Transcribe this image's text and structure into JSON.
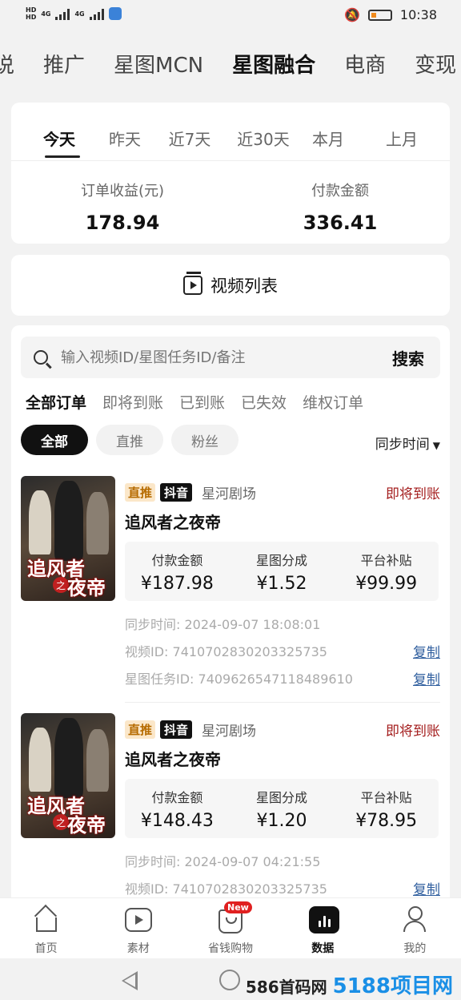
{
  "status_bar": {
    "time": "10:38",
    "hd": "HD",
    "net": "4G"
  },
  "top_tabs": [
    "说",
    "推广",
    "星图MCN",
    "星图融合",
    "电商",
    "变现"
  ],
  "date_tabs": [
    "今天",
    "昨天",
    "近7天",
    "近30天",
    "本月",
    "上月"
  ],
  "summary": {
    "order_income_label": "订单收益(元)",
    "order_income_value": "178.94",
    "payment_label": "付款金额",
    "payment_value": "336.41"
  },
  "video_list_label": "视频列表",
  "search": {
    "placeholder": "输入视频ID/星图任务ID/备注",
    "button": "搜索"
  },
  "order_tabs": [
    "全部订单",
    "即将到账",
    "已到账",
    "已失效",
    "维权订单"
  ],
  "chips": [
    "全部",
    "直推",
    "粉丝"
  ],
  "sort_label": "同步时间",
  "orders": [
    {
      "tag_type": "直推",
      "platform": "抖音",
      "source": "星河剧场",
      "status": "即将到账",
      "title": "追风者之夜帝",
      "poster_text_1": "追风者",
      "poster_text_2": "夜帝",
      "poster_zhi": "之",
      "pay_label": "付款金额",
      "pay_value": "¥187.98",
      "share_label": "星图分成",
      "share_value": "¥1.52",
      "subsidy_label": "平台补贴",
      "subsidy_value": "¥99.99",
      "sync_time": "同步时间:  2024-09-07 18:08:01",
      "video_id": "视频ID:  7410702830203325735",
      "task_id": "星图任务ID:  7409626547118489610",
      "copy": "复制"
    },
    {
      "tag_type": "直推",
      "platform": "抖音",
      "source": "星河剧场",
      "status": "即将到账",
      "title": "追风者之夜帝",
      "poster_text_1": "追风者",
      "poster_text_2": "夜帝",
      "poster_zhi": "之",
      "pay_label": "付款金额",
      "pay_value": "¥148.43",
      "share_label": "星图分成",
      "share_value": "¥1.20",
      "subsidy_label": "平台补贴",
      "subsidy_value": "¥78.95",
      "sync_time": "同步时间:  2024-09-07 04:21:55",
      "video_id": "视频ID:  7410702830203325735",
      "copy": "复制"
    }
  ],
  "bottom_nav": [
    {
      "label": "首页"
    },
    {
      "label": "素材"
    },
    {
      "label": "省钱购物",
      "badge": "New"
    },
    {
      "label": "数据"
    },
    {
      "label": "我的"
    }
  ],
  "watermark": {
    "prefix": "586首码网",
    "suffix": "5188项目网"
  }
}
